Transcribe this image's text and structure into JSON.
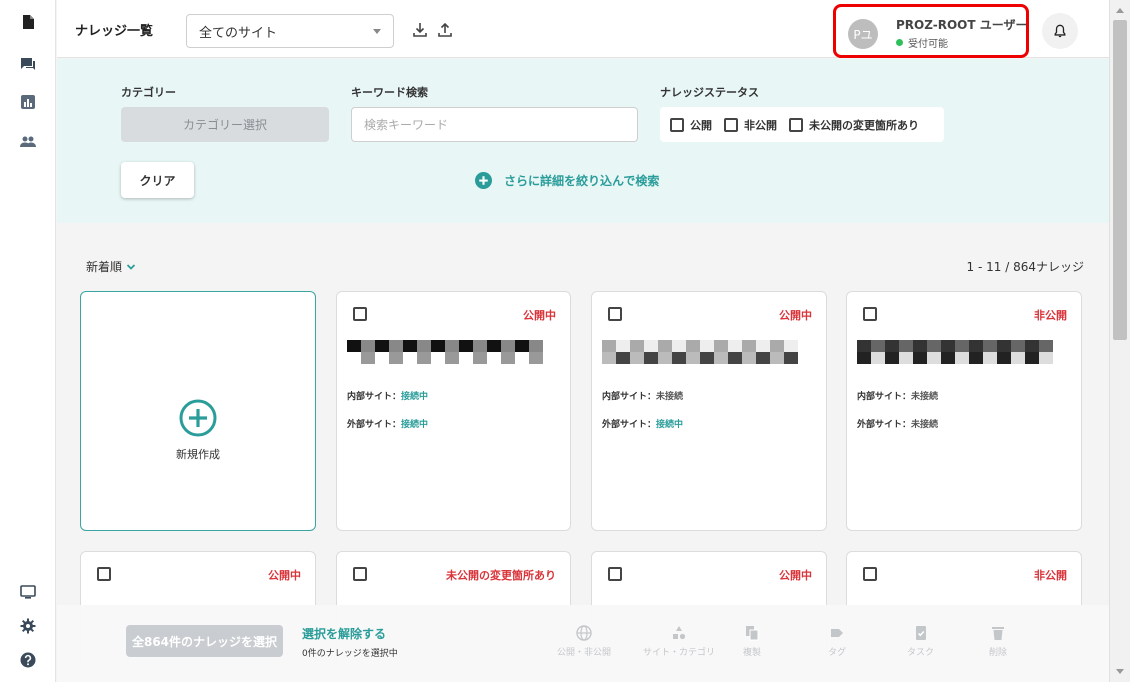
{
  "header": {
    "title": "ナレッジ一覧",
    "site_select": "全てのサイト",
    "user": {
      "avatar_text": "Pユ",
      "name": "PROZ-ROOT ユーザー",
      "status": "受付可能",
      "status_color": "#2fbf5a"
    }
  },
  "filter": {
    "category_label": "カテゴリー",
    "category_button": "カテゴリー選択",
    "keyword_label": "キーワード検索",
    "keyword_placeholder": "検索キーワード",
    "keyword_value": "",
    "status_label": "ナレッジステータス",
    "status_options": [
      "公開",
      "非公開",
      "未公開の変更箇所あり"
    ],
    "clear_button": "クリア",
    "advanced_link": "さらに詳細を絞り込んで検索"
  },
  "list": {
    "sort_label": "新着順",
    "count_text": "1 - 11 / 864ナレッジ",
    "new_card_label": "新規作成",
    "internal_label": "内部サイト：",
    "external_label": "外部サイト：",
    "cards_row1": [
      {
        "status": "公開中",
        "internal": "接続中",
        "external": "接続中"
      },
      {
        "status": "公開中",
        "internal": "未接続",
        "external": "接続中"
      },
      {
        "status": "非公開",
        "internal": "未接続",
        "external": "未接続"
      }
    ],
    "cards_row2": [
      {
        "status": "公開中"
      },
      {
        "status": "未公開の変更箇所あり"
      },
      {
        "status": "公開中"
      },
      {
        "status": "非公開"
      }
    ]
  },
  "bottom_bar": {
    "select_all_button": "全864件のナレッジを選択",
    "deselect_link": "選択を解除する",
    "selected_count": "0件のナレッジを選択中",
    "actions": [
      "公開・非公開",
      "サイト・カテゴリ",
      "複製",
      "タグ",
      "タスク",
      "削除"
    ]
  },
  "colors": {
    "accent": "#2a9d9a",
    "status_red": "#d9343a",
    "highlight_border": "#e00000"
  },
  "icons": {
    "rail": [
      "document-icon",
      "chat-icon",
      "chart-icon",
      "users-icon",
      "monitor-icon",
      "gear-icon",
      "help-icon"
    ],
    "header": [
      "download-icon",
      "upload-icon",
      "bell-icon"
    ]
  }
}
